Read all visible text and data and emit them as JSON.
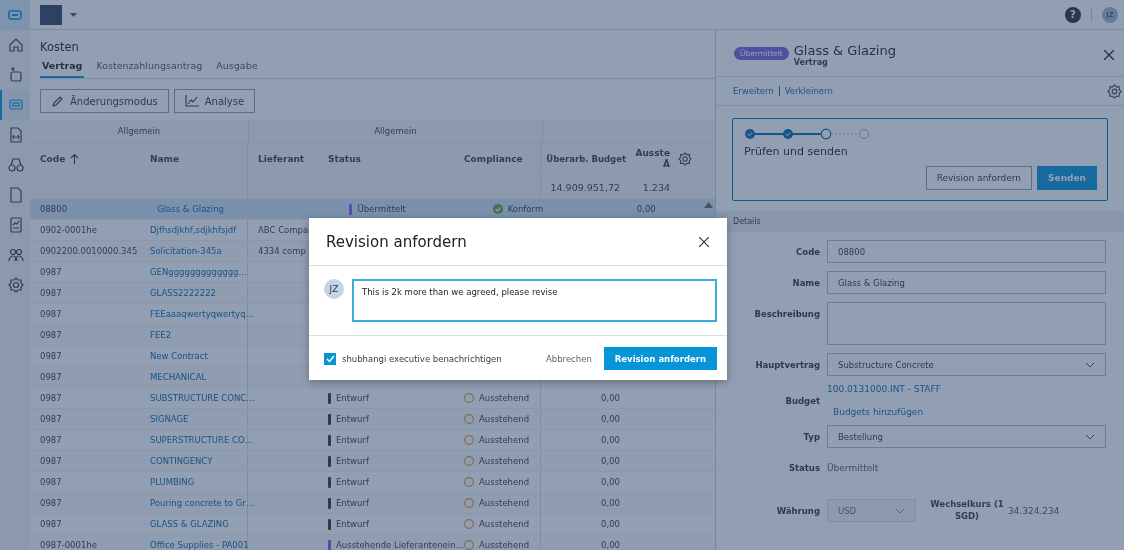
{
  "topbar": {
    "avatar": "JZ",
    "help": "?"
  },
  "sidebar": {
    "items": [
      {
        "selected": false
      },
      {
        "selected": false
      },
      {
        "selected": true
      },
      {
        "selected": false
      },
      {
        "selected": false
      },
      {
        "selected": false
      },
      {
        "selected": false
      },
      {
        "selected": false
      },
      {
        "selected": false
      }
    ]
  },
  "page": {
    "title": "Kosten",
    "tabs": [
      {
        "label": "Vertrag",
        "selected": true
      },
      {
        "label": "Kostenzahlungsantrag",
        "selected": false
      },
      {
        "label": "Ausgabe",
        "selected": false
      }
    ],
    "toolbar": [
      {
        "kind": "edit",
        "label": "Änderungsmodus"
      },
      {
        "kind": "chart",
        "label": "Analyse"
      }
    ]
  },
  "table": {
    "groups": [
      "Allgemein",
      "Allgemein"
    ],
    "columns": [
      {
        "label": "Code",
        "sorted": true
      },
      {
        "label": "Name",
        "sorted": false
      },
      {
        "label": "Lieferant",
        "sorted": false
      },
      {
        "label": "Status",
        "sorted": false
      },
      {
        "label": "Compliance",
        "sorted": false
      },
      {
        "label": "Überarb. Budget",
        "sorted": false
      },
      {
        "label": "Ausste Ä",
        "sorted": false
      }
    ],
    "totals": [
      "14.909.951,72",
      "1.234"
    ],
    "rows": [
      {
        "code": "08800",
        "name": "Glass & Glazing",
        "status": {
          "label": "Übermittelt",
          "color": "#5a4ba8"
        },
        "compliance": {
          "label": "Konform",
          "kind": "ok"
        },
        "budget": "0,00",
        "selected": true
      },
      {
        "code": "0902-0001he",
        "name": "Djfhsdjkhf,sdjkhfsjdf",
        "supplier": "ABC Compa",
        "selected": false
      },
      {
        "code": "0902200.0010000.345",
        "name": "Solicitation-345a",
        "supplier": "4334 comp",
        "selected": false
      },
      {
        "code": "0987",
        "name": "GENggggggggggggg…",
        "selected": false
      },
      {
        "code": "0987",
        "name": "GLASS2222222",
        "selected": false
      },
      {
        "code": "0987",
        "name": "FEEaaaqwertyqwertyq…",
        "selected": false
      },
      {
        "code": "0987",
        "name": "FEE2",
        "selected": false
      },
      {
        "code": "0987",
        "name": "New Contract",
        "selected": false
      },
      {
        "code": "0987",
        "name": "MECHANICAL",
        "selected": false
      },
      {
        "code": "0987",
        "name": "SUBSTRUCTURE CONC…",
        "status": {
          "label": "Entwurf",
          "color": "#2c3a4f"
        },
        "compliance": {
          "label": "Ausstehend",
          "kind": "pending"
        },
        "budget": "0,00",
        "selected": false
      },
      {
        "code": "0987",
        "name": "SIGNAGE",
        "status": {
          "label": "Entwurf",
          "color": "#2c3a4f"
        },
        "compliance": {
          "label": "Ausstehend",
          "kind": "pending"
        },
        "budget": "0,00",
        "selected": false
      },
      {
        "code": "0987",
        "name": "SUPERSTRUCTURE CO…",
        "status": {
          "label": "Entwurf",
          "color": "#2c3a4f"
        },
        "compliance": {
          "label": "Ausstehend",
          "kind": "pending"
        },
        "budget": "0,00",
        "selected": false
      },
      {
        "code": "0987",
        "name": "CONTINGENCY",
        "status": {
          "label": "Entwurf",
          "color": "#2c3a4f"
        },
        "compliance": {
          "label": "Ausstehend",
          "kind": "pending"
        },
        "budget": "0,00",
        "selected": false
      },
      {
        "code": "0987",
        "name": "PLUMBING",
        "status": {
          "label": "Entwurf",
          "color": "#2c3a4f"
        },
        "compliance": {
          "label": "Ausstehend",
          "kind": "pending"
        },
        "budget": "0,00",
        "selected": false
      },
      {
        "code": "0987",
        "name": "Pouring concrete to Gr…",
        "status": {
          "label": "Entwurf",
          "color": "#2c3a4f"
        },
        "compliance": {
          "label": "Ausstehend",
          "kind": "pending"
        },
        "budget": "0,00",
        "selected": false
      },
      {
        "code": "0987",
        "name": "GLASS & GLAZING",
        "status": {
          "label": "Entwurf",
          "color": "#2c3a4f"
        },
        "compliance": {
          "label": "Ausstehend",
          "kind": "pending"
        },
        "budget": "0,00",
        "selected": false
      },
      {
        "code": "0987-0001he",
        "name": "Office Supplies - PA001",
        "status": {
          "label": "Ausstehende Lieferantenein…",
          "color": "#5a4ba8"
        },
        "compliance": {
          "label": "Ausstehend",
          "kind": "pending"
        },
        "budget": "0,00",
        "selected": false
      }
    ]
  },
  "panel": {
    "badge": "Übermittelt",
    "title": "Glass & Glazing",
    "subtitle": "Vertrag",
    "links": [
      "Erweitern",
      "Verkleinern"
    ],
    "steps": [
      {
        "kind": "done"
      },
      {
        "kind": "done"
      },
      {
        "kind": "current"
      },
      {
        "kind": "todo"
      }
    ],
    "step_title": "Prüfen und senden",
    "buttons": [
      {
        "kind": "secondary",
        "label": "Revision anfordern"
      },
      {
        "kind": "primary",
        "label": "Senden"
      }
    ],
    "section": "Details",
    "fields": [
      {
        "kind": "input",
        "label": "Code",
        "value": "08800"
      },
      {
        "kind": "input",
        "label": "Name",
        "value": "Glass & Glazing"
      },
      {
        "kind": "textarea",
        "label": "Beschreibung"
      },
      {
        "kind": "select",
        "label": "Hauptvertrag",
        "value": "Substructure Concrete"
      },
      {
        "kind": "link",
        "label": "Budget",
        "value": "100.0131000.INT - STAFF",
        "extra": "Budgets hinzufügen"
      },
      {
        "kind": "select",
        "label": "Typ",
        "value": "Bestellung"
      },
      {
        "kind": "text",
        "label": "Status",
        "value": "Übermittelt"
      }
    ],
    "currency": {
      "label": "Währung",
      "value": "USD",
      "disabled": true,
      "rate_label": "Wechselkurs (1 SGD)",
      "rate": "34.324.234"
    }
  },
  "dialog": {
    "title": "Revision anfordern",
    "avatar": "JZ",
    "comment": "This is 2k more than we agreed, please revise",
    "notify": {
      "label": "shubhangi executive benachrichtigen",
      "checked": true
    },
    "cancel": "Abbrechen",
    "submit": "Revision anfordern"
  }
}
